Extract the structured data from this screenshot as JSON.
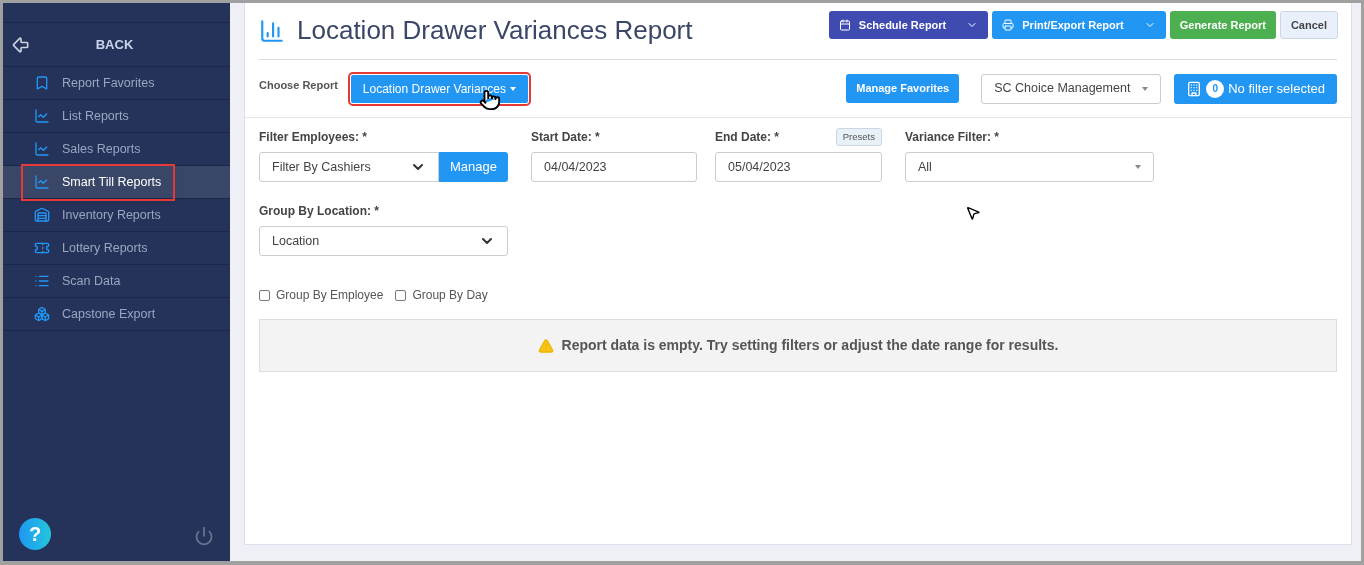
{
  "sidebar": {
    "back_label": "BACK",
    "items": [
      {
        "label": "Report Favorites",
        "kind": "bookmark",
        "selected": false,
        "annotated": false
      },
      {
        "label": "List Reports",
        "kind": "chart",
        "selected": false,
        "annotated": false
      },
      {
        "label": "Sales Reports",
        "kind": "chart",
        "selected": false,
        "annotated": false
      },
      {
        "label": "Smart Till Reports",
        "kind": "chart",
        "selected": true,
        "annotated": true
      },
      {
        "label": "Inventory Reports",
        "kind": "warehouse",
        "selected": false,
        "annotated": false
      },
      {
        "label": "Lottery Reports",
        "kind": "ticket",
        "selected": false,
        "annotated": false
      },
      {
        "label": "Scan Data",
        "kind": "list",
        "selected": false,
        "annotated": false
      },
      {
        "label": "Capstone Export",
        "kind": "boxes",
        "selected": false,
        "annotated": false
      }
    ],
    "help": "?"
  },
  "header": {
    "title": "Location Drawer Variances Report",
    "buttons": [
      {
        "label": "Schedule Report",
        "kind": "schedule"
      },
      {
        "label": "Print/Export Report",
        "kind": "print"
      },
      {
        "label": "Generate Report",
        "kind": "generate"
      },
      {
        "label": "Cancel",
        "kind": "cancel"
      }
    ]
  },
  "report_bar": {
    "choose_label": "Choose Report",
    "report_button": {
      "label": "Location Drawer Variances",
      "annotated": true
    },
    "manage_favorites": "Manage Favorites",
    "store_select": "SC Choice Management",
    "filter_count": "0",
    "filter_label": "No filter selected"
  },
  "filters": {
    "employees": {
      "label": "Filter Employees: *",
      "value": "Filter By Cashiers",
      "button": "Manage"
    },
    "start_date": {
      "label": "Start Date: *",
      "value": "04/04/2023"
    },
    "end_date": {
      "label": "End Date: *",
      "value": "05/04/2023",
      "presets": "Presets"
    },
    "variance": {
      "label": "Variance Filter: *",
      "value": "All"
    },
    "group_location": {
      "label": "Group By Location: *",
      "value": "Location"
    },
    "checkboxes": [
      {
        "label": "Group By Employee",
        "checked": false
      },
      {
        "label": "Group By Day",
        "checked": false
      }
    ]
  },
  "notice": "Report data is empty. Try setting filters or adjust the date range for results."
}
